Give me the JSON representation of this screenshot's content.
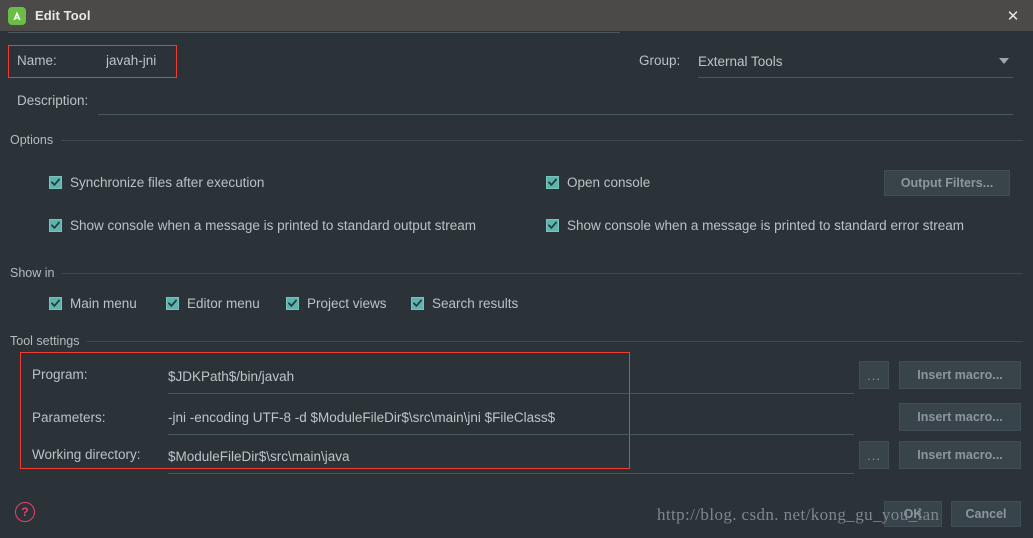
{
  "window": {
    "title": "Edit Tool",
    "app_icon": "android-studio-icon",
    "close_icon": "close-icon",
    "background_color": "#2b3338",
    "titlebar_color": "#4b4a48",
    "accent_color": "#5fb3ad",
    "highlight_color": "#f03c34"
  },
  "name_field": {
    "label": "Name:",
    "value": "javah-jni",
    "placeholder": ""
  },
  "group_field": {
    "label": "Group:",
    "value": "External Tools",
    "dropdown_icon": "chevron-down-icon"
  },
  "description_field": {
    "label": "Description:",
    "value": "",
    "placeholder": ""
  },
  "options": {
    "title": "Options",
    "checkboxes": [
      {
        "label": "Synchronize files after execution",
        "checked": true
      },
      {
        "label": "Open console",
        "checked": true
      },
      {
        "label": "Show console when a message is printed to standard output stream",
        "checked": true
      },
      {
        "label": "Show console when a message is printed to standard error stream",
        "checked": true
      }
    ],
    "output_filters_button": "Output Filters..."
  },
  "show_in": {
    "title": "Show in",
    "checkboxes": [
      {
        "label": "Main menu",
        "checked": true
      },
      {
        "label": "Editor menu",
        "checked": true
      },
      {
        "label": "Project views",
        "checked": true
      },
      {
        "label": "Search results",
        "checked": true
      }
    ]
  },
  "tool_settings": {
    "title": "Tool settings",
    "rows": [
      {
        "label": "Program:",
        "value": "$JDKPath$/bin/javah",
        "browse_label": "...",
        "has_browse": true,
        "macro_label": "Insert macro..."
      },
      {
        "label": "Parameters:",
        "value": "-jni  -encoding UTF-8 -d  $ModuleFileDir$\\src\\main\\jni $FileClass$",
        "browse_label": "...",
        "has_browse": false,
        "macro_label": "Insert macro..."
      },
      {
        "label": "Working directory:",
        "value": "$ModuleFileDir$\\src\\main\\java",
        "browse_label": "...",
        "has_browse": true,
        "macro_label": "Insert macro..."
      }
    ]
  },
  "footer": {
    "help_icon": "help-question-icon",
    "help_glyph": "?",
    "ok_button": "OK",
    "cancel_button": "Cancel",
    "watermark": "http://blog. csdn. net/kong_gu_you_lan"
  }
}
